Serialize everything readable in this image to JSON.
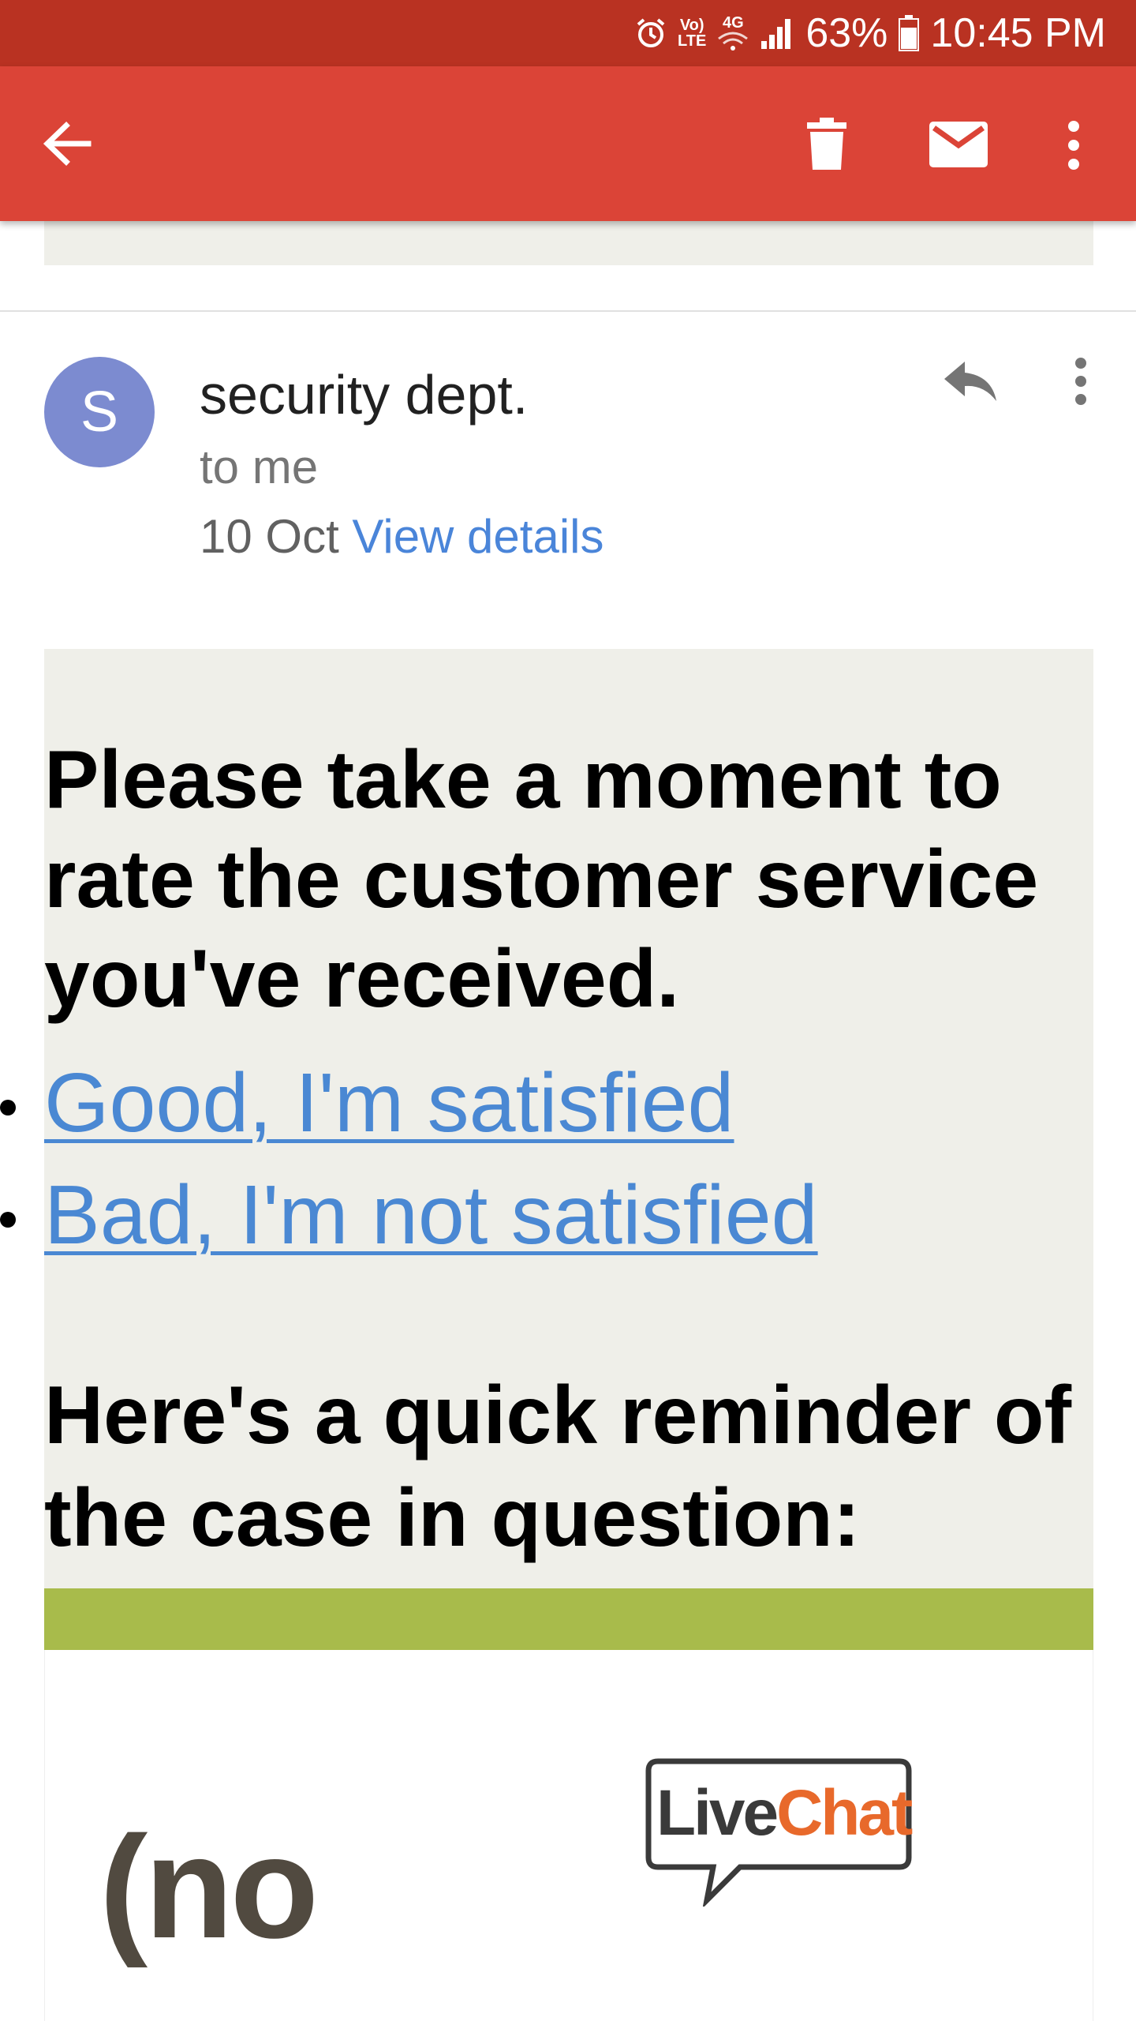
{
  "status_bar": {
    "volte_line1": "Vo)",
    "volte_line2": "LTE",
    "network": "4G",
    "battery": "63%",
    "time": "10:45 PM",
    "icons": [
      "alarm-icon",
      "volte-icon",
      "network-4g-icon",
      "signal-icon",
      "battery-icon"
    ]
  },
  "toolbar": {
    "icons": [
      "back-arrow-icon",
      "trash-icon",
      "mail-icon",
      "more-vert-icon"
    ]
  },
  "message_header": {
    "avatar_letter": "S",
    "sender": "security dept.",
    "recipient": "to me",
    "date": "10 Oct",
    "view_details": "View details",
    "icons": [
      "reply-icon",
      "more-vert-icon"
    ]
  },
  "body": {
    "headline": "Please take a moment to rate the customer service you've received.",
    "ratings": [
      "Good, I'm satisfied",
      "Bad, I'm not satisfied"
    ],
    "reminder": "Here's a quick reminder of the case in question:",
    "logo_text_1": "Live",
    "logo_text_2": "Chat",
    "partial_text": "(no"
  },
  "colors": {
    "status_bar": "#b93222",
    "toolbar": "#db4437",
    "avatar": "#7c8bd0",
    "link": "#4a88d3",
    "body_bg": "#efefe9",
    "green_bar": "#a8bb4b",
    "livechat_orange": "#e8692b"
  }
}
